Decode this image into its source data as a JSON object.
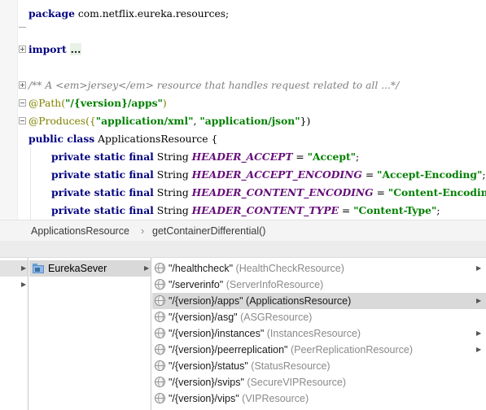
{
  "editor": {
    "package_kw": "package",
    "package_name": " com.netflix.eureka.resources;",
    "import_kw": "import",
    "import_folded": "...",
    "doc_comment": "/** A <em>jersey</em> resource that handles request related to all ...*/",
    "path_annotation": "@Path(",
    "path_value": "\"/{version}/apps\"",
    "path_close": ")",
    "produces_annotation": "@Produces({",
    "produces_xml": "\"application/xml\"",
    "produces_sep": ", ",
    "produces_json": "\"application/json\"",
    "produces_close": "})",
    "class_kw": "public class",
    "class_name": " ApplicationsResource {",
    "fields": [
      {
        "modifiers": "private static final",
        "type": " String ",
        "name": "HEADER_ACCEPT",
        "eq": " = ",
        "value": "\"Accept\"",
        "end": ";"
      },
      {
        "modifiers": "private static final",
        "type": " String ",
        "name": "HEADER_ACCEPT_ENCODING",
        "eq": " = ",
        "value": "\"Accept-Encoding\"",
        "end": ";"
      },
      {
        "modifiers": "private static final",
        "type": " String ",
        "name": "HEADER_CONTENT_ENCODING",
        "eq": " = ",
        "value": "\"Content-Encoding\"",
        "end": ";"
      },
      {
        "modifiers": "private static final",
        "type": " String ",
        "name": "HEADER_CONTENT_TYPE",
        "eq": " = ",
        "value": "\"Content-Type\"",
        "end": ";"
      }
    ]
  },
  "breadcrumb": {
    "class": "ApplicationsResource",
    "separator": "›",
    "method": "getContainerDifferential()"
  },
  "tree": {
    "project": "EurekaSever",
    "resources": [
      {
        "path": "\"/healthcheck\"",
        "class": " (HealthCheckResource)"
      },
      {
        "path": "\"/serverinfo\"",
        "class": " (ServerInfoResource)"
      },
      {
        "path": "\"/{version}/apps\"",
        "class": " (ApplicationsResource)"
      },
      {
        "path": "\"/{version}/asg\"",
        "class": " (ASGResource)"
      },
      {
        "path": "\"/{version}/instances\"",
        "class": " (InstancesResource)"
      },
      {
        "path": "\"/{version}/peerreplication\"",
        "class": " (PeerReplicationResource)"
      },
      {
        "path": "\"/{version}/status\"",
        "class": " (StatusResource)"
      },
      {
        "path": "\"/{version}/svips\"",
        "class": " (SecureVIPResource)"
      },
      {
        "path": "\"/{version}/vips\"",
        "class": " (VIPResource)"
      }
    ]
  }
}
